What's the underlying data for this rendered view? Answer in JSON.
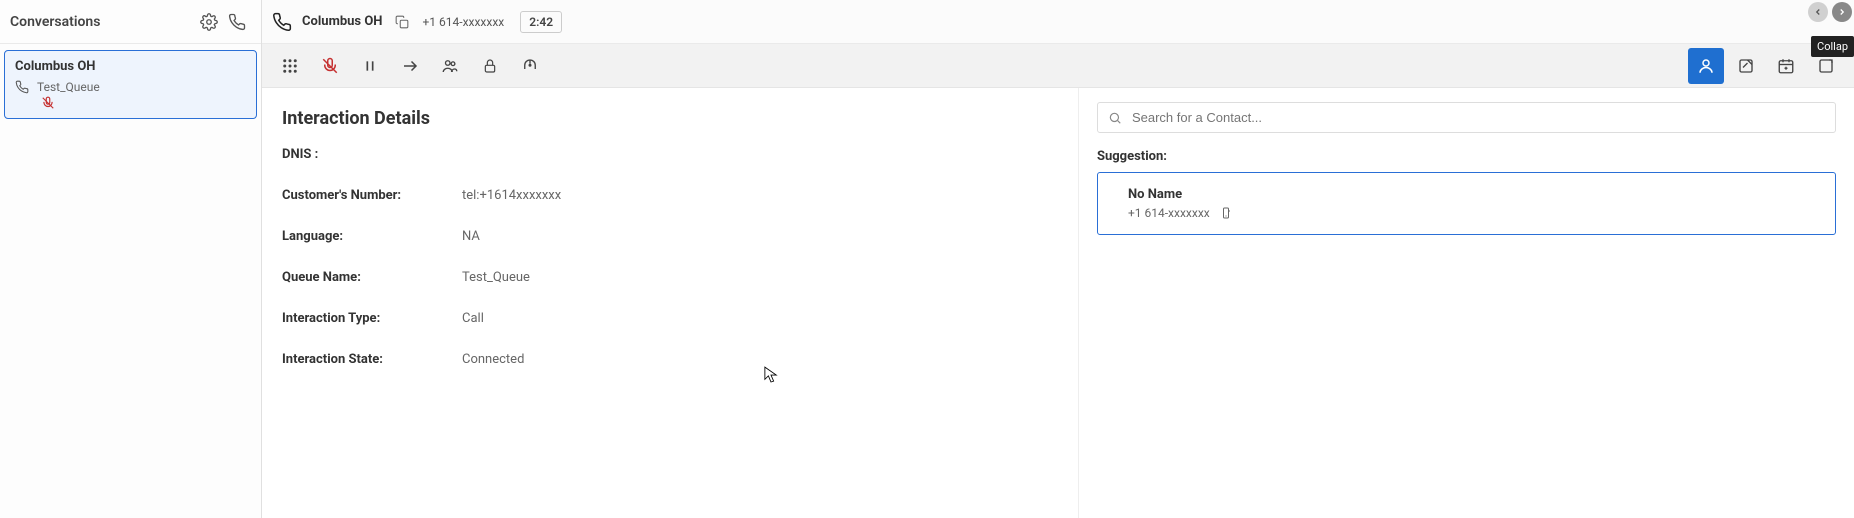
{
  "sidebar": {
    "title": "Conversations",
    "card": {
      "title": "Columbus OH",
      "queue": "Test_Queue"
    }
  },
  "callbar": {
    "name": "Columbus OH",
    "phone": "+1 614-xxxxxxx",
    "timer": "2:42"
  },
  "details": {
    "heading": "Interaction Details",
    "fields": {
      "dnis_label": "DNIS :",
      "dnis_value": "",
      "custnum_label": "Customer's Number:",
      "custnum_value": "tel:+1614xxxxxxx",
      "language_label": "Language:",
      "language_value": "NA",
      "queue_label": "Queue Name:",
      "queue_value": "Test_Queue",
      "type_label": "Interaction Type:",
      "type_value": "Call",
      "state_label": "Interaction State:",
      "state_value": "Connected"
    }
  },
  "contact": {
    "search_placeholder": "Search for a Contact...",
    "suggestion_label": "Suggestion:",
    "card": {
      "name": "No Name",
      "phone": "+1 614-xxxxxxx"
    }
  },
  "tooltip": "Collap"
}
